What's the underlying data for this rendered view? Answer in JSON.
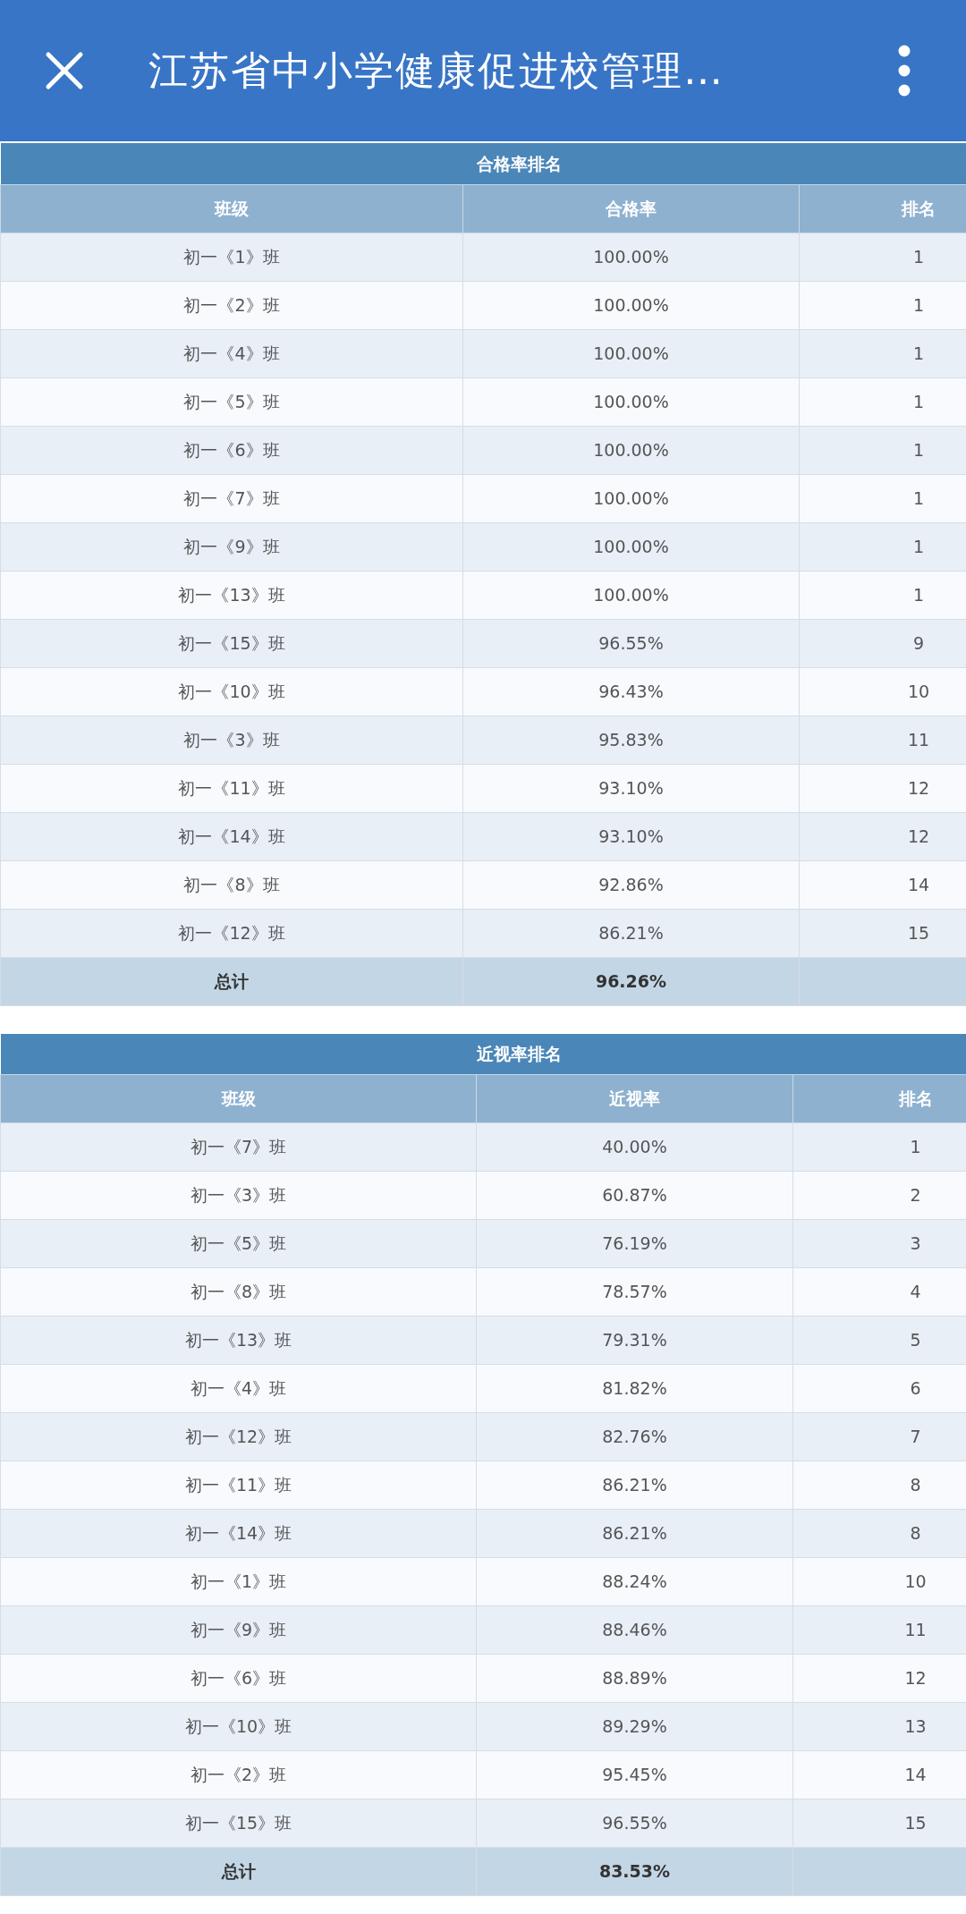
{
  "header": {
    "title": "江苏省中小学健康促进校管理…"
  },
  "tables": [
    {
      "title": "合格率排名",
      "columns": [
        "班级",
        "合格率",
        "排名"
      ],
      "rows": [
        {
          "class": "初一《1》班",
          "value": "100.00%",
          "rank": "1"
        },
        {
          "class": "初一《2》班",
          "value": "100.00%",
          "rank": "1"
        },
        {
          "class": "初一《4》班",
          "value": "100.00%",
          "rank": "1"
        },
        {
          "class": "初一《5》班",
          "value": "100.00%",
          "rank": "1"
        },
        {
          "class": "初一《6》班",
          "value": "100.00%",
          "rank": "1"
        },
        {
          "class": "初一《7》班",
          "value": "100.00%",
          "rank": "1"
        },
        {
          "class": "初一《9》班",
          "value": "100.00%",
          "rank": "1"
        },
        {
          "class": "初一《13》班",
          "value": "100.00%",
          "rank": "1"
        },
        {
          "class": "初一《15》班",
          "value": "96.55%",
          "rank": "9"
        },
        {
          "class": "初一《10》班",
          "value": "96.43%",
          "rank": "10"
        },
        {
          "class": "初一《3》班",
          "value": "95.83%",
          "rank": "11"
        },
        {
          "class": "初一《11》班",
          "value": "93.10%",
          "rank": "12"
        },
        {
          "class": "初一《14》班",
          "value": "93.10%",
          "rank": "12"
        },
        {
          "class": "初一《8》班",
          "value": "92.86%",
          "rank": "14"
        },
        {
          "class": "初一《12》班",
          "value": "86.21%",
          "rank": "15"
        }
      ],
      "total": {
        "label": "总计",
        "value": "96.26%"
      }
    },
    {
      "title": "近视率排名",
      "columns": [
        "班级",
        "近视率",
        "排名"
      ],
      "rows": [
        {
          "class": "初一《7》班",
          "value": "40.00%",
          "rank": "1"
        },
        {
          "class": "初一《3》班",
          "value": "60.87%",
          "rank": "2"
        },
        {
          "class": "初一《5》班",
          "value": "76.19%",
          "rank": "3"
        },
        {
          "class": "初一《8》班",
          "value": "78.57%",
          "rank": "4"
        },
        {
          "class": "初一《13》班",
          "value": "79.31%",
          "rank": "5"
        },
        {
          "class": "初一《4》班",
          "value": "81.82%",
          "rank": "6"
        },
        {
          "class": "初一《12》班",
          "value": "82.76%",
          "rank": "7"
        },
        {
          "class": "初一《11》班",
          "value": "86.21%",
          "rank": "8"
        },
        {
          "class": "初一《14》班",
          "value": "86.21%",
          "rank": "8"
        },
        {
          "class": "初一《1》班",
          "value": "88.24%",
          "rank": "10"
        },
        {
          "class": "初一《9》班",
          "value": "88.46%",
          "rank": "11"
        },
        {
          "class": "初一《6》班",
          "value": "88.89%",
          "rank": "12"
        },
        {
          "class": "初一《10》班",
          "value": "89.29%",
          "rank": "13"
        },
        {
          "class": "初一《2》班",
          "value": "95.45%",
          "rank": "14"
        },
        {
          "class": "初一《15》班",
          "value": "96.55%",
          "rank": "15"
        }
      ],
      "total": {
        "label": "总计",
        "value": "83.53%"
      }
    }
  ]
}
